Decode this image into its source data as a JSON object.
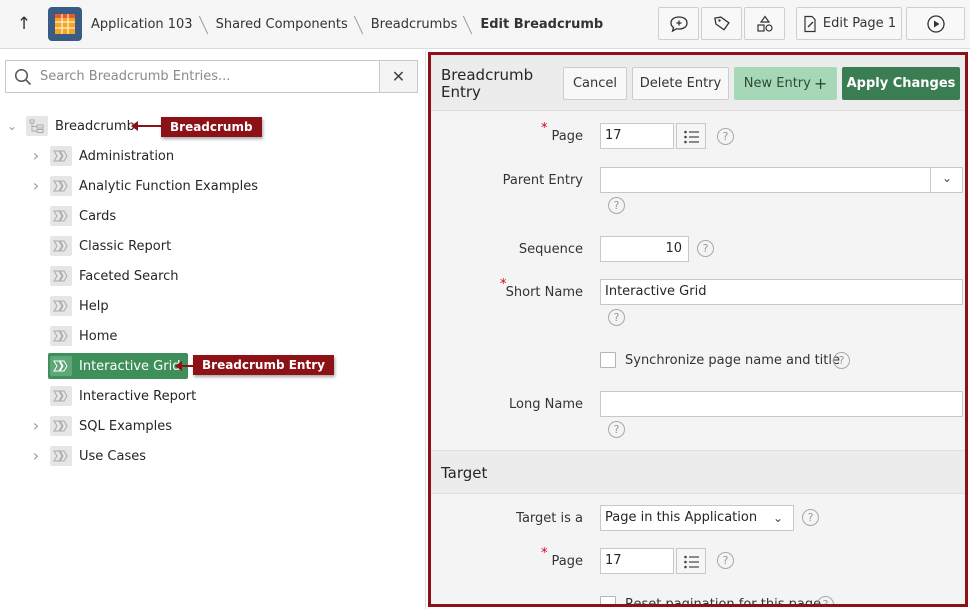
{
  "topbar": {
    "breadcrumbs": [
      "Application 103",
      "Shared Components",
      "Breadcrumbs",
      "Edit Breadcrumb"
    ],
    "edit_page_label": "Edit Page 1",
    "icons": [
      "up-arrow-icon",
      "app-grid-icon",
      "comment-icon",
      "tag-icon",
      "shapes-icon",
      "edit-page-icon",
      "run-icon"
    ]
  },
  "tree": {
    "search_placeholder": "Search Breadcrumb Entries...",
    "root_label": "Breadcrumb",
    "items": [
      {
        "label": "Administration",
        "expandable": true
      },
      {
        "label": "Analytic Function Examples",
        "expandable": true
      },
      {
        "label": "Cards",
        "expandable": false
      },
      {
        "label": "Classic Report",
        "expandable": false
      },
      {
        "label": "Faceted Search",
        "expandable": false
      },
      {
        "label": "Help",
        "expandable": false
      },
      {
        "label": "Home",
        "expandable": false
      },
      {
        "label": "Interactive Grid",
        "expandable": false,
        "selected": true
      },
      {
        "label": "Interactive Report",
        "expandable": false
      },
      {
        "label": "SQL Examples",
        "expandable": true
      },
      {
        "label": "Use Cases",
        "expandable": true
      }
    ]
  },
  "callouts": {
    "breadcrumb": "Breadcrumb",
    "entry": "Breadcrumb Entry"
  },
  "form": {
    "region_title": "Breadcrumb Entry",
    "buttons": {
      "cancel": "Cancel",
      "delete": "Delete Entry",
      "new": "New Entry",
      "apply": "Apply Changes"
    },
    "fields": {
      "page_label": "Page",
      "page_value": "17",
      "parent_label": "Parent Entry",
      "parent_value": "",
      "sequence_label": "Sequence",
      "sequence_value": "10",
      "short_name_label": "Short Name",
      "short_name_value": "Interactive Grid",
      "sync_label": "Synchronize page name and title",
      "long_name_label": "Long Name",
      "long_name_value": ""
    },
    "target": {
      "section_title": "Target",
      "target_is_label": "Target is a",
      "target_is_value": "Page in this Application",
      "page_label": "Page",
      "page_value": "17",
      "reset_label": "Reset pagination for this page"
    }
  },
  "colors": {
    "accent_green": "#3b7d52",
    "light_green": "#a6d8b8",
    "callout_red": "#8c1217",
    "required_red": "#d0021b"
  }
}
